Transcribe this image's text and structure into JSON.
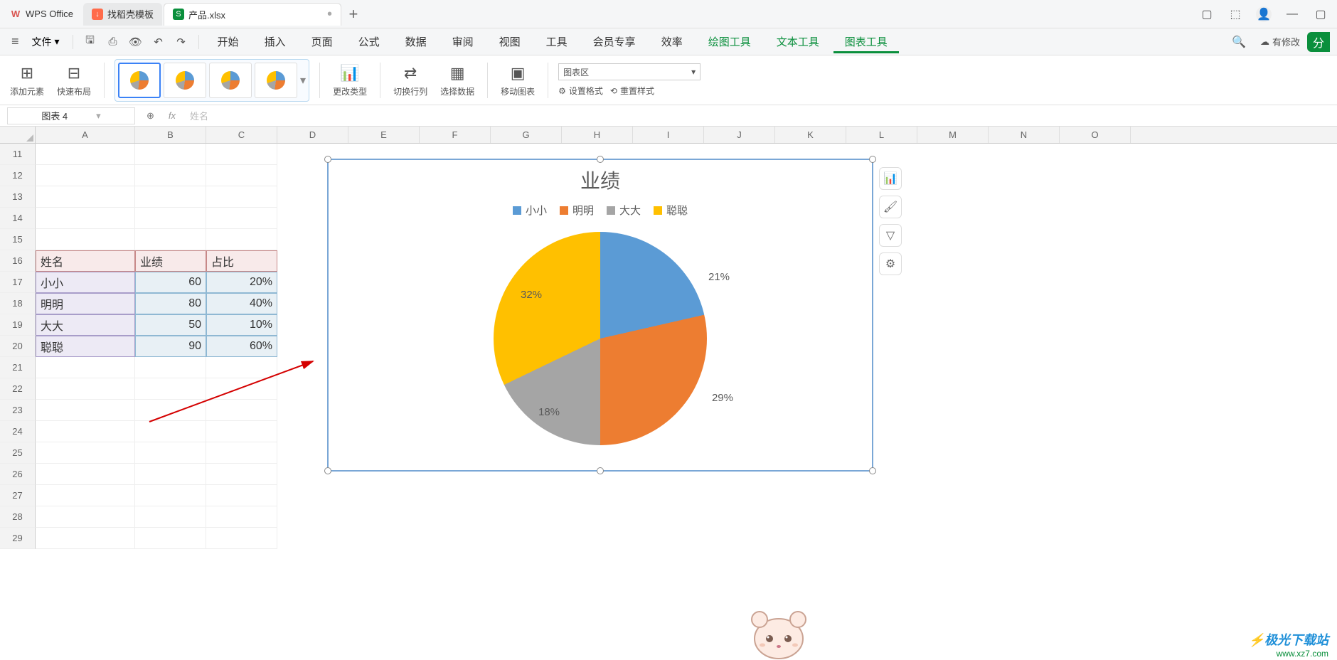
{
  "titlebar": {
    "app_name": "WPS Office",
    "tabs": [
      {
        "icon": "↓",
        "label": "找稻壳模板"
      },
      {
        "icon": "S",
        "label": "产品.xlsx"
      }
    ],
    "add": "+"
  },
  "menubar": {
    "file": "文件",
    "items": [
      "开始",
      "插入",
      "页面",
      "公式",
      "数据",
      "审阅",
      "视图",
      "工具",
      "会员专享",
      "效率",
      "绘图工具",
      "文本工具",
      "图表工具"
    ],
    "status": "有修改",
    "share": "分"
  },
  "ribbon": {
    "add_element": "添加元素",
    "quick_layout": "快速布局",
    "change_type": "更改类型",
    "switch_rowcol": "切换行列",
    "select_data": "选择数据",
    "move_chart": "移动图表",
    "chart_area": "图表区",
    "set_format": "设置格式",
    "reset_style": "重置样式"
  },
  "fbar": {
    "name_box": "图表 4",
    "fx": "姓名"
  },
  "sheet": {
    "cols": [
      "A",
      "B",
      "C",
      "D",
      "E",
      "F",
      "G",
      "H",
      "I",
      "J",
      "K",
      "L",
      "M",
      "N",
      "O"
    ],
    "rows": [
      "11",
      "12",
      "13",
      "14",
      "15",
      "16",
      "17",
      "18",
      "19",
      "20",
      "21",
      "22",
      "23",
      "24",
      "25",
      "26",
      "27",
      "28",
      "29"
    ],
    "headers": {
      "name": "姓名",
      "perf": "业绩",
      "pct": "占比"
    },
    "data": [
      {
        "name": "小小",
        "perf": "60",
        "pct": "20%"
      },
      {
        "name": "明明",
        "perf": "80",
        "pct": "40%"
      },
      {
        "name": "大大",
        "perf": "50",
        "pct": "10%"
      },
      {
        "name": "聪聪",
        "perf": "90",
        "pct": "60%"
      }
    ]
  },
  "chart": {
    "title": "业绩",
    "legend": [
      "小小",
      "明明",
      "大大",
      "聪聪"
    ],
    "labels": [
      "21%",
      "29%",
      "18%",
      "32%"
    ],
    "colors": {
      "blue": "#5b9bd5",
      "orange": "#ed7d31",
      "gray": "#a5a5a5",
      "yellow": "#ffc000"
    }
  },
  "chart_data": {
    "type": "pie",
    "title": "业绩",
    "categories": [
      "小小",
      "明明",
      "大大",
      "聪聪"
    ],
    "values": [
      60,
      80,
      50,
      90
    ],
    "percent_labels": [
      "21%",
      "29%",
      "18%",
      "32%"
    ],
    "colors": [
      "#5b9bd5",
      "#ed7d31",
      "#a5a5a5",
      "#ffc000"
    ],
    "legend_position": "top"
  },
  "watermark": {
    "brand": "极光下载站",
    "url": "www.xz7.com"
  }
}
